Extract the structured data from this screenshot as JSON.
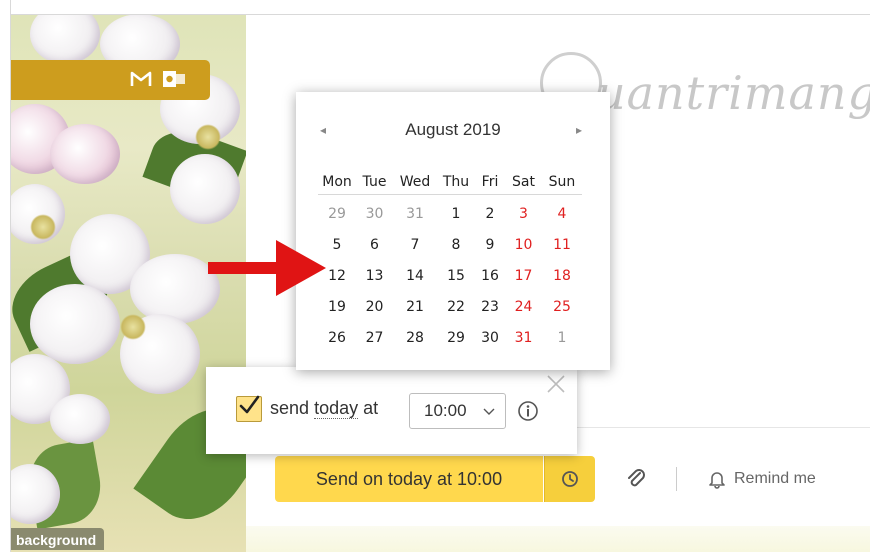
{
  "sidebar": {
    "background_label": "background",
    "mail_icon": "gmail-icon",
    "outlook_icon": "outlook-icon",
    "bar_color": "#cd9d1e"
  },
  "watermark": {
    "text": "uantrimang"
  },
  "calendar": {
    "title": "August 2019",
    "prev_icon": "◂",
    "next_icon": "▸",
    "weekdays": [
      "Mon",
      "Tue",
      "Wed",
      "Thu",
      "Fri",
      "Sat",
      "Sun"
    ],
    "weeks": [
      [
        {
          "d": "29",
          "muted": true
        },
        {
          "d": "30",
          "muted": true
        },
        {
          "d": "31",
          "muted": true
        },
        {
          "d": "1"
        },
        {
          "d": "2"
        },
        {
          "d": "3",
          "weekend": true
        },
        {
          "d": "4",
          "weekend": true
        }
      ],
      [
        {
          "d": "5"
        },
        {
          "d": "6"
        },
        {
          "d": "7"
        },
        {
          "d": "8"
        },
        {
          "d": "9"
        },
        {
          "d": "10",
          "weekend": true
        },
        {
          "d": "11",
          "weekend": true
        }
      ],
      [
        {
          "d": "12"
        },
        {
          "d": "13"
        },
        {
          "d": "14"
        },
        {
          "d": "15"
        },
        {
          "d": "16"
        },
        {
          "d": "17",
          "weekend": true
        },
        {
          "d": "18",
          "weekend": true
        }
      ],
      [
        {
          "d": "19"
        },
        {
          "d": "20"
        },
        {
          "d": "21"
        },
        {
          "d": "22"
        },
        {
          "d": "23"
        },
        {
          "d": "24",
          "weekend": true
        },
        {
          "d": "25",
          "weekend": true
        }
      ],
      [
        {
          "d": "26"
        },
        {
          "d": "27"
        },
        {
          "d": "28"
        },
        {
          "d": "29"
        },
        {
          "d": "30"
        },
        {
          "d": "31",
          "weekend": true
        },
        {
          "d": "1",
          "muted": true
        }
      ]
    ],
    "weekend_color": "#e02020"
  },
  "schedule": {
    "checked": true,
    "send_prefix": "send",
    "today_link": "today",
    "at_text": "at",
    "time_value": "10:00",
    "info_icon": "info-icon"
  },
  "toolbar": {
    "send_button": "Send on today at 10:00",
    "clock_icon": "clock-icon",
    "attach_icon": "paperclip-icon",
    "remind_label": "Remind me",
    "send_color": "#ffd84d"
  }
}
